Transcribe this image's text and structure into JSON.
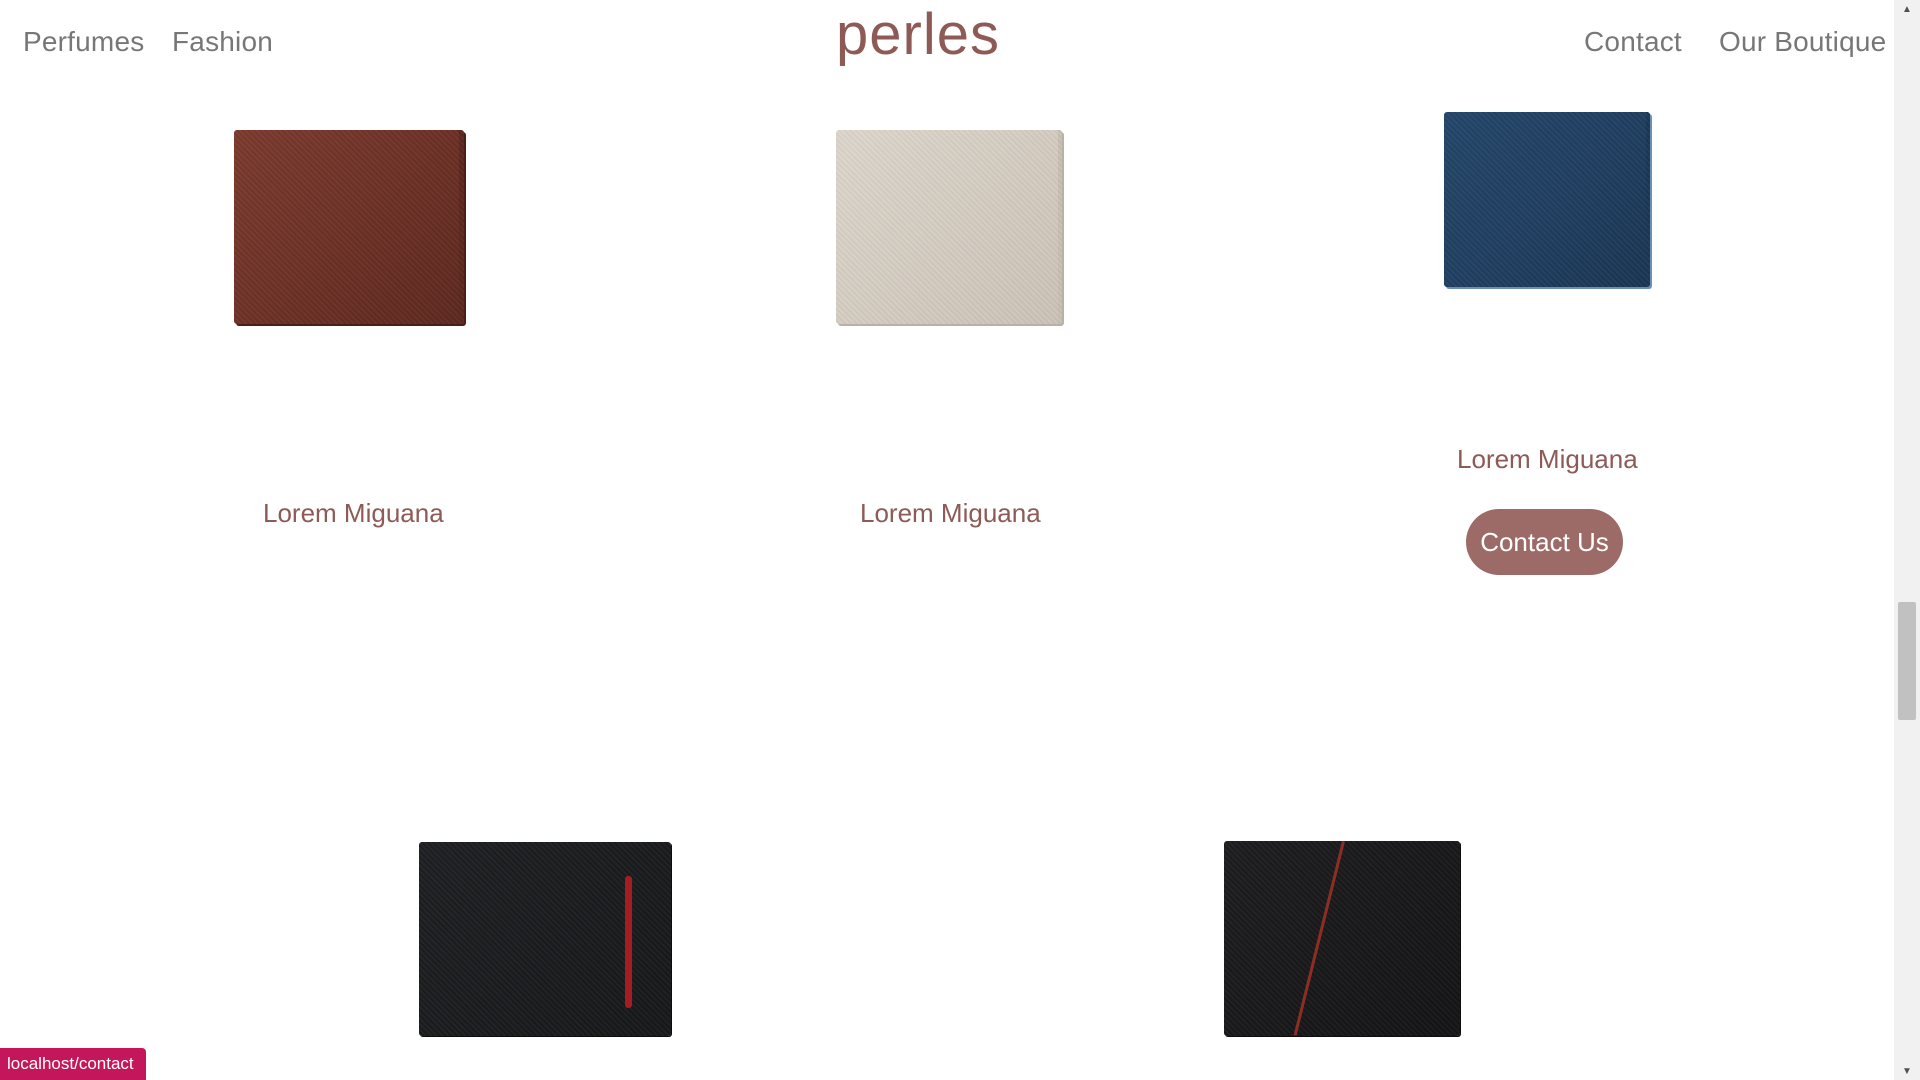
{
  "header": {
    "logo": "perles",
    "nav_left": [
      "Perfumes",
      "Fashion"
    ],
    "nav_right": [
      "Contact",
      "Our Boutique"
    ]
  },
  "products": [
    {
      "name": "Lorem Miguana",
      "color": "#6a2f24"
    },
    {
      "name": "Lorem Miguana",
      "color": "#d3cbc0"
    },
    {
      "name": "Lorem Miguana",
      "color": "#1f3d5f",
      "button": "Contact Us"
    },
    {
      "name": "",
      "color": "#17181a"
    },
    {
      "name": "",
      "color": "#141416"
    }
  ],
  "colors": {
    "accent": "#8e5a55",
    "button": "#9d6b67",
    "status_bg": "#c4165b"
  },
  "status_url": "localhost/contact"
}
